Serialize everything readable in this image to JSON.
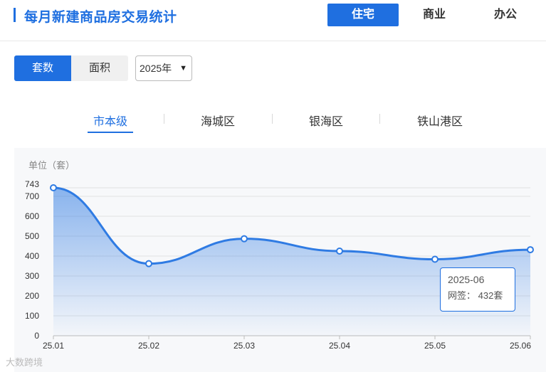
{
  "header": {
    "title": "每月新建商品房交易统计",
    "categories": [
      "住宅",
      "商业",
      "办公"
    ],
    "active_category": "住宅"
  },
  "controls": {
    "metric_tabs": [
      "套数",
      "面积"
    ],
    "active_metric": "套数",
    "year_select": "2025年"
  },
  "districts": {
    "tabs": [
      "市本级",
      "海城区",
      "银海区",
      "铁山港区"
    ],
    "active": "市本级"
  },
  "chart_data": {
    "type": "area",
    "unit_label": "单位（套）",
    "categories": [
      "25.01",
      "25.02",
      "25.03",
      "25.04",
      "25.05",
      "25.06"
    ],
    "values": [
      743,
      362,
      487,
      425,
      384,
      432
    ],
    "y_ticks": [
      "743",
      "700",
      "600",
      "500",
      "400",
      "300",
      "200",
      "100",
      "0"
    ],
    "ylim": [
      0,
      743
    ],
    "grid": true,
    "accent_color": "#2f7be3"
  },
  "tooltip": {
    "date": "2025-06",
    "label": "网签：",
    "value": "432套"
  },
  "watermark": "大数跨境"
}
